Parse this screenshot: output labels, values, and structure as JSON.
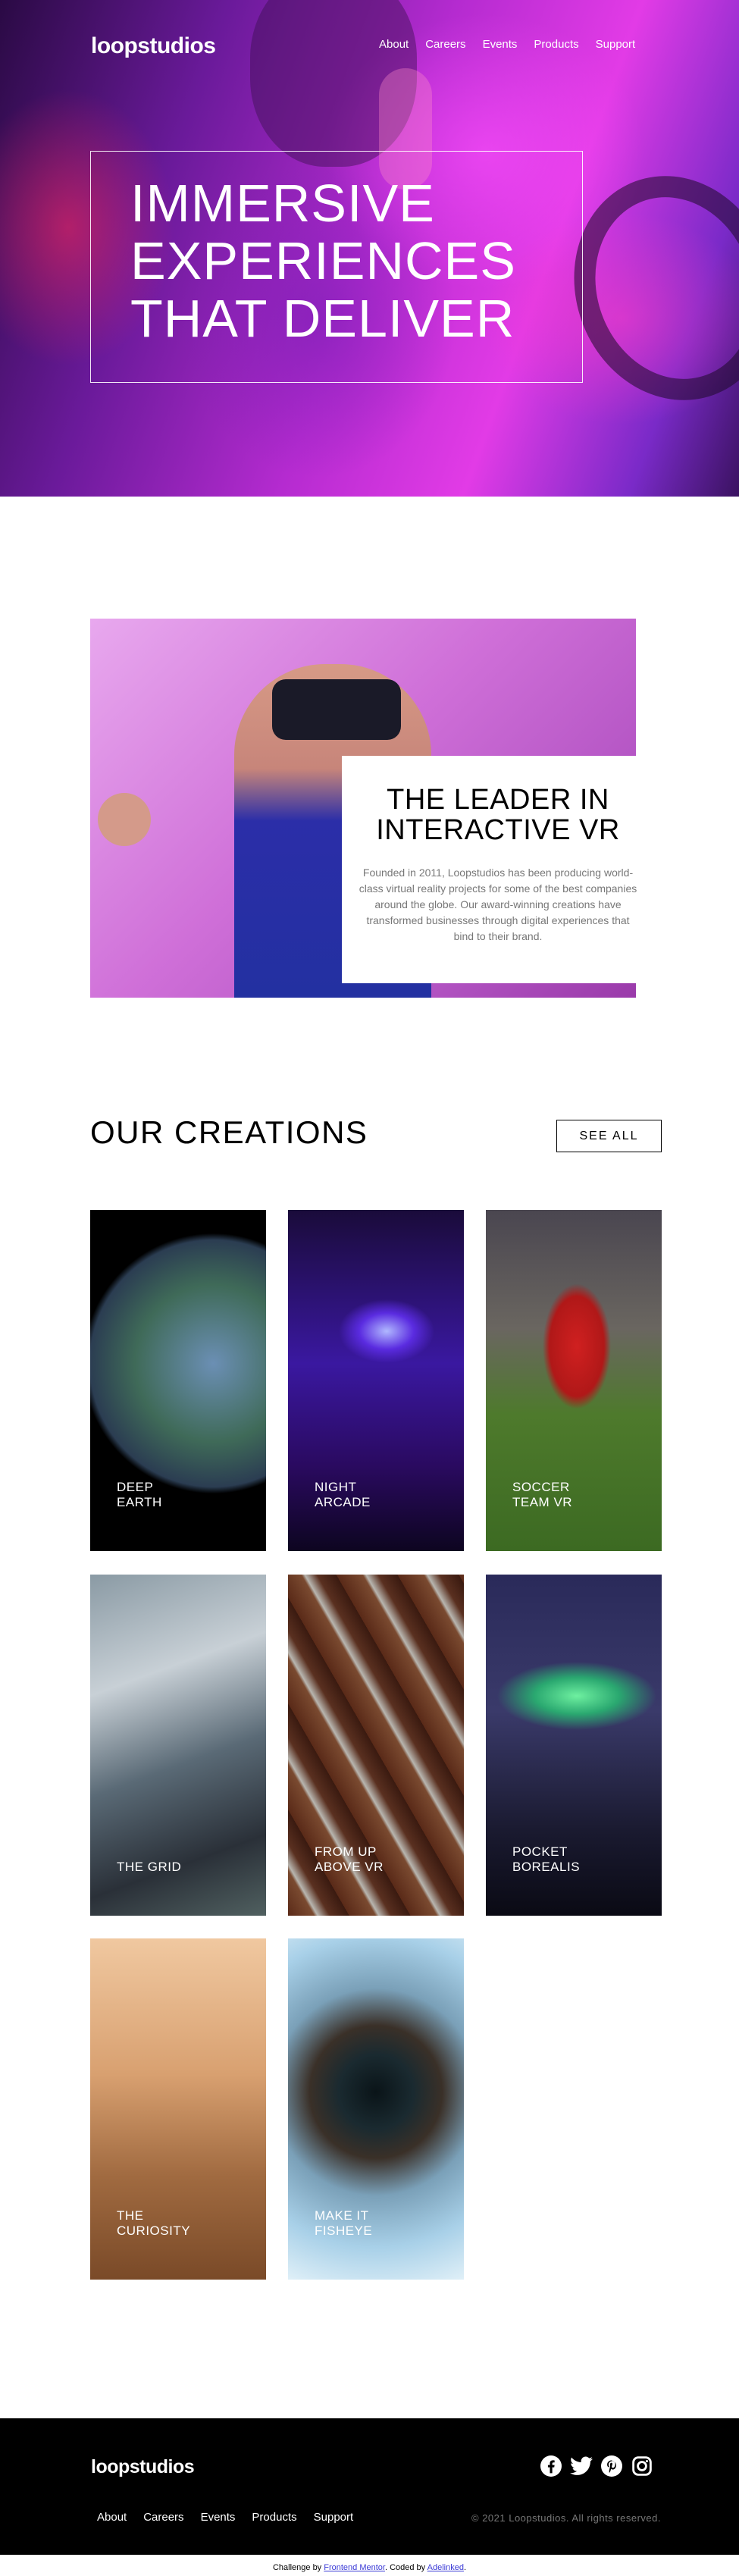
{
  "header": {
    "logo": "loopstudios",
    "nav": [
      "About",
      "Careers",
      "Events",
      "Products",
      "Support"
    ]
  },
  "hero": {
    "title": "IMMERSIVE EXPERIENCES THAT DELIVER"
  },
  "interactive": {
    "title": "THE LEADER IN INTERACTIVE VR",
    "text": "Founded in 2011, Loopstudios has been producing world-class virtual reality projects for some of the best companies around the globe. Our award-winning creations have transformed businesses through digital experiences that bind to their brand."
  },
  "creations": {
    "title": "OUR CREATIONS",
    "see_all": "SEE ALL",
    "items": [
      {
        "label": "DEEP\nEARTH"
      },
      {
        "label": "NIGHT\nARCADE"
      },
      {
        "label": "SOCCER\nTEAM VR"
      },
      {
        "label": "THE GRID"
      },
      {
        "label": "FROM UP\nABOVE VR"
      },
      {
        "label": "POCKET\nBOREALIS"
      },
      {
        "label": "THE\nCURIOSITY"
      },
      {
        "label": "MAKE IT\nFISHEYE"
      }
    ]
  },
  "footer": {
    "logo": "loopstudios",
    "nav": [
      "About",
      "Careers",
      "Events",
      "Products",
      "Support"
    ],
    "copyright": "© 2021 Loopstudios. All rights reserved.",
    "socials": [
      "facebook-icon",
      "twitter-icon",
      "pinterest-icon",
      "instagram-icon"
    ]
  },
  "attribution": {
    "prefix": "Challenge by ",
    "challenge_link": "Frontend Mentor",
    "middle": ". Coded by ",
    "author_link": "Adelinked",
    "suffix": "."
  }
}
